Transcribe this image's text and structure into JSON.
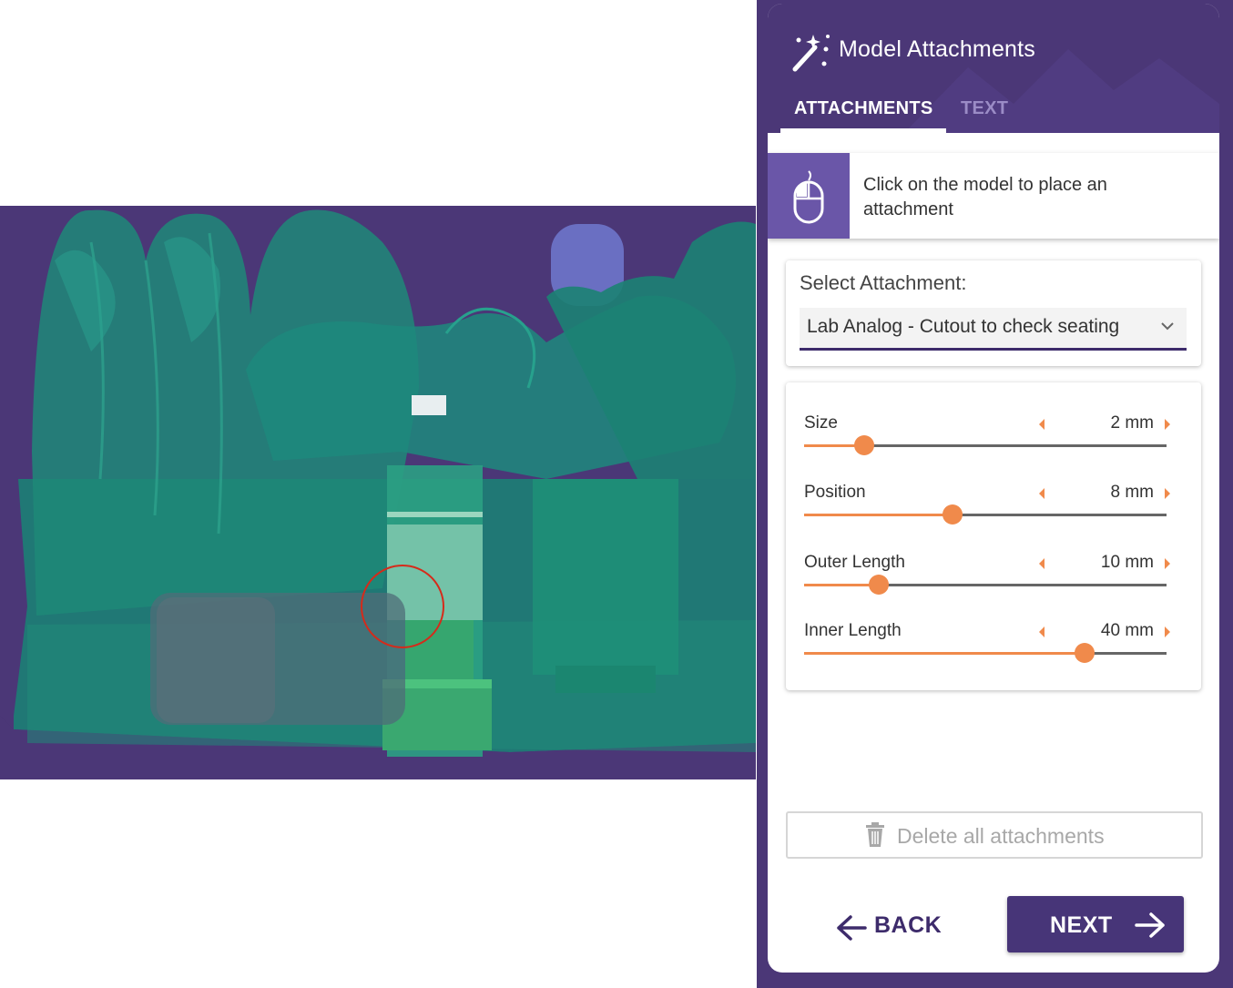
{
  "viewport": {
    "background": "#4b3777",
    "model_color": "#1f8a7a",
    "selection_ring_color": "#d62a1a"
  },
  "panel": {
    "title": "Model Attachments",
    "title_icon": "magic-wand-icon",
    "tabs": [
      {
        "label": "ATTACHMENTS",
        "active": true
      },
      {
        "label": "TEXT",
        "active": false
      }
    ],
    "hint": {
      "icon": "mouse-icon",
      "text": "Click on the model to place an attachment"
    },
    "select": {
      "label": "Select Attachment:",
      "value": "Lab Analog - Cutout to check seating"
    },
    "sliders": [
      {
        "label": "Size",
        "value": "2 mm",
        "fraction": 0.165
      },
      {
        "label": "Position",
        "value": "8 mm",
        "fraction": 0.41
      },
      {
        "label": "Outer Length",
        "value": "10 mm",
        "fraction": 0.205
      },
      {
        "label": "Inner Length",
        "value": "40 mm",
        "fraction": 0.775
      }
    ],
    "delete_label": "Delete all attachments",
    "back_label": "BACK",
    "next_label": "NEXT",
    "accent_color": "#f08a4b",
    "brand_color": "#4b3777"
  }
}
